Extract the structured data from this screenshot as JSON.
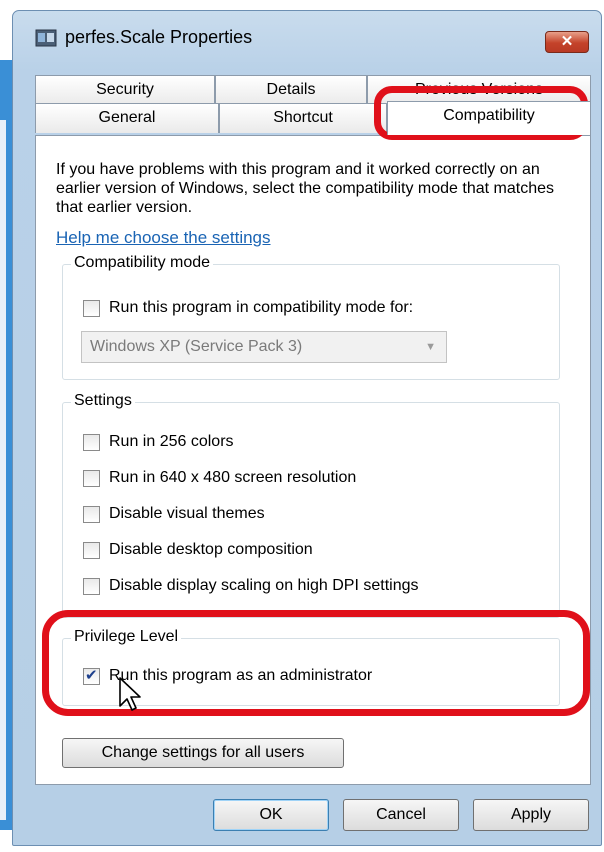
{
  "window": {
    "title": "perfes.Scale Properties",
    "close_label": "✕"
  },
  "tabs": {
    "row1": [
      "Security",
      "Details",
      "Previous Versions"
    ],
    "row2": [
      "General",
      "Shortcut",
      "Compatibility"
    ],
    "active": "Compatibility"
  },
  "panel": {
    "intro": "If you have problems with this program and it worked correctly on an earlier version of Windows, select the compatibility mode that matches that earlier version.",
    "help_link": "Help me choose the settings",
    "compat_group": {
      "label": "Compatibility mode",
      "checkbox_label": "Run this program in compatibility mode for:",
      "checked": false,
      "select_value": "Windows XP (Service Pack 3)"
    },
    "settings_group": {
      "label": "Settings",
      "items": [
        {
          "label": "Run in 256 colors",
          "checked": false
        },
        {
          "label": "Run in 640 x 480 screen resolution",
          "checked": false
        },
        {
          "label": "Disable visual themes",
          "checked": false
        },
        {
          "label": "Disable desktop composition",
          "checked": false
        },
        {
          "label": "Disable display scaling on high DPI settings",
          "checked": false
        }
      ]
    },
    "privilege_group": {
      "label": "Privilege Level",
      "checkbox_label": "Run this program as an administrator",
      "checked": true
    },
    "change_all_button": "Change settings for all users"
  },
  "buttons": {
    "ok": "OK",
    "cancel": "Cancel",
    "apply": "Apply"
  },
  "colors": {
    "highlight_red": "#e0101a",
    "link_blue": "#1a64b4",
    "title_bar": "#c9dced"
  }
}
